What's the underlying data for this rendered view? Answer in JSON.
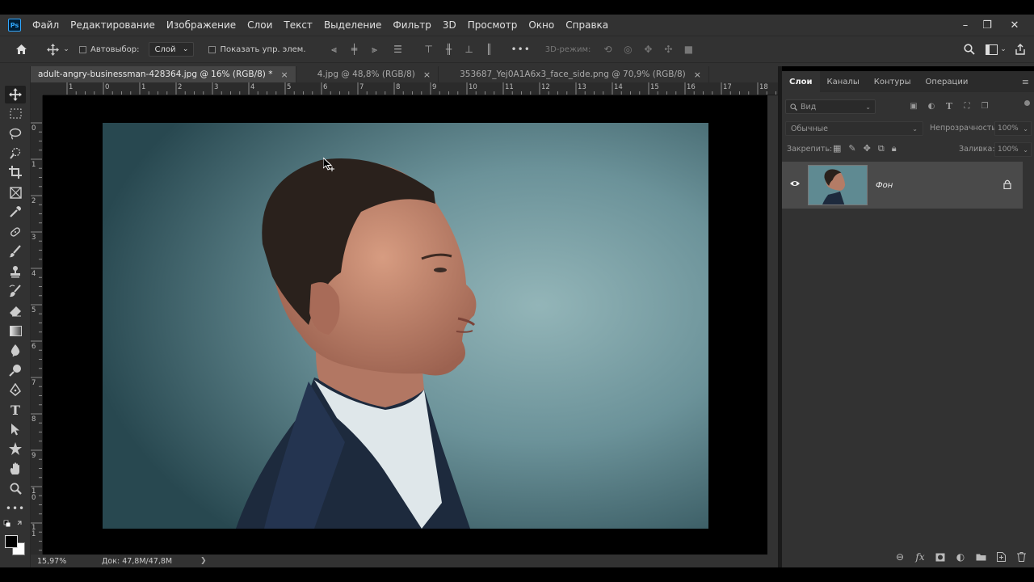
{
  "app": {
    "logo": "Ps"
  },
  "menu": {
    "items": [
      "Файл",
      "Редактирование",
      "Изображение",
      "Слои",
      "Текст",
      "Выделение",
      "Фильтр",
      "3D",
      "Просмотр",
      "Окно",
      "Справка"
    ]
  },
  "window_controls": {
    "minimize": "–",
    "restore": "❐",
    "close": "✕"
  },
  "options_bar": {
    "autoselect_label": "Автовыбор:",
    "autoselect_target": "Слой",
    "show_controls_label": "Показать упр. элем.",
    "more": "•••",
    "mode_3d_label": "3D-режим:"
  },
  "tabs": [
    {
      "label": "adult-angry-businessman-428364.jpg @ 16% (RGB/8) *",
      "active": true
    },
    {
      "label": "4.jpg @ 48,8% (RGB/8)",
      "active": false
    },
    {
      "label": "353687_Yej0A1A6x3_face_side.png @ 70,9% (RGB/8)",
      "active": false
    }
  ],
  "tab_close": "×",
  "ruler_h_ticks": [
    "1",
    "0",
    "1",
    "2",
    "3",
    "4",
    "5",
    "6",
    "7",
    "8",
    "9",
    "10",
    "11",
    "12",
    "13",
    "14",
    "15",
    "16",
    "17",
    "18"
  ],
  "ruler_v_ticks": [
    "0",
    "1",
    "2",
    "3",
    "4",
    "5",
    "6",
    "7",
    "8",
    "9",
    "1 0",
    "1 1"
  ],
  "status": {
    "zoom": "15,97%",
    "doc": "Док: 47,8M/47,8M",
    "arrow": "❯"
  },
  "layers_panel": {
    "tabs": [
      "Слои",
      "Каналы",
      "Контуры",
      "Операции"
    ],
    "search_placeholder": "Вид",
    "blend_mode": "Обычные",
    "opacity_label": "Непрозрачность:",
    "opacity_value": "100%",
    "lock_label": "Закрепить:",
    "fill_label": "Заливка:",
    "fill_value": "100%",
    "layers": [
      {
        "name": "Фон",
        "visible": true,
        "locked": true
      }
    ],
    "bottom_icons": [
      "link-icon",
      "fx-icon",
      "mask-icon",
      "adjustment-icon",
      "group-icon",
      "new-layer-icon",
      "trash-icon"
    ],
    "fx_label": "fx"
  },
  "colors": {
    "accent": "#31a8ff",
    "panel_bg": "#323232",
    "canvas_bg": "#000000",
    "photo_bg": "#5b8890"
  }
}
